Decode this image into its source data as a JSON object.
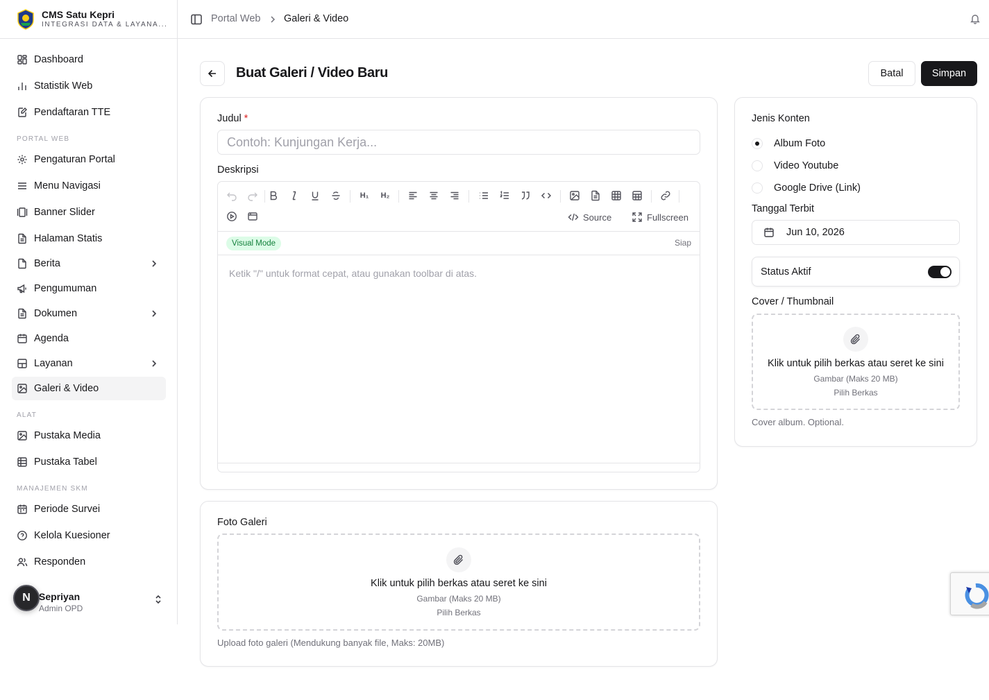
{
  "brand": {
    "title": "CMS Satu Kepri",
    "subtitle": "INTEGRASI DATA & LAYANA..."
  },
  "sidebar": {
    "items_top": [
      {
        "label": "Dashboard",
        "icon": "dashboard-icon"
      },
      {
        "label": "Statistik Web",
        "icon": "bar-chart-icon"
      },
      {
        "label": "Pendaftaran TTE",
        "icon": "edit-document-icon"
      }
    ],
    "group_portal": "PORTAL WEB",
    "items_portal": [
      {
        "label": "Pengaturan Portal",
        "icon": "gear-icon"
      },
      {
        "label": "Menu Navigasi",
        "icon": "menu-icon"
      },
      {
        "label": "Banner Slider",
        "icon": "gallery-horizontal-icon"
      },
      {
        "label": "Halaman Statis",
        "icon": "file-text-icon"
      },
      {
        "label": "Berita",
        "icon": "newspaper-icon",
        "has_children": true
      },
      {
        "label": "Pengumuman",
        "icon": "megaphone-icon"
      },
      {
        "label": "Dokumen",
        "icon": "file-icon",
        "has_children": true
      },
      {
        "label": "Agenda",
        "icon": "calendar-icon"
      },
      {
        "label": "Layanan",
        "icon": "layers-icon",
        "has_children": true
      },
      {
        "label": "Galeri & Video",
        "icon": "image-icon",
        "active": true
      }
    ],
    "group_alat": "ALAT",
    "items_alat": [
      {
        "label": "Pustaka Media",
        "icon": "image-icon"
      },
      {
        "label": "Pustaka Tabel",
        "icon": "table-icon"
      }
    ],
    "group_skm": "MANAJEMEN SKM",
    "items_skm": [
      {
        "label": "Periode Survei",
        "icon": "calendar-range-icon"
      },
      {
        "label": "Kelola Kuesioner",
        "icon": "help-circle-icon"
      },
      {
        "label": "Responden",
        "icon": "users-icon"
      }
    ],
    "user": {
      "initial": "N",
      "name": "Sepriyan",
      "role": "Admin OPD"
    }
  },
  "breadcrumb": {
    "parent": "Portal Web",
    "current": "Galeri & Video"
  },
  "page": {
    "title": "Buat Galeri / Video Baru",
    "cancel_label": "Batal",
    "save_label": "Simpan"
  },
  "form": {
    "title_label": "Judul",
    "title_required": "*",
    "title_placeholder": "Contoh: Kunjungan Kerja...",
    "title_value": "",
    "desc_label": "Deskripsi",
    "editor": {
      "source_label": "Source",
      "fullscreen_label": "Fullscreen",
      "mode_badge": "Visual Mode",
      "status": "Siap",
      "placeholder": "Ketik \"/\" untuk format cepat, atau gunakan toolbar di atas."
    },
    "gallery": {
      "label": "Foto Galeri",
      "drop_title": "Klik untuk pilih berkas atau seret ke sini",
      "drop_sub": "Gambar (Maks 20 MB)",
      "drop_action": "Pilih Berkas",
      "helper": "Upload foto galeri (Mendukung banyak file, Maks: 20MB)"
    }
  },
  "side": {
    "content_type_label": "Jenis Konten",
    "content_types": [
      {
        "label": "Album Foto",
        "selected": true
      },
      {
        "label": "Video Youtube",
        "selected": false
      },
      {
        "label": "Google Drive (Link)",
        "selected": false
      }
    ],
    "publish_label": "Tanggal Terbit",
    "publish_value": "Jun 10, 2026",
    "status_label": "Status Aktif",
    "status_on": true,
    "cover_label": "Cover / Thumbnail",
    "cover_drop_title": "Klik untuk pilih berkas atau seret ke sini",
    "cover_drop_sub": "Gambar (Maks 20 MB)",
    "cover_drop_action": "Pilih Berkas",
    "cover_helper": "Cover album. Optional."
  },
  "colors": {
    "primary": "#18181b",
    "border": "#e4e4e7",
    "muted": "#71717a",
    "badge_bg": "#dcfce7",
    "badge_fg": "#15803d",
    "required": "#dc2626"
  }
}
